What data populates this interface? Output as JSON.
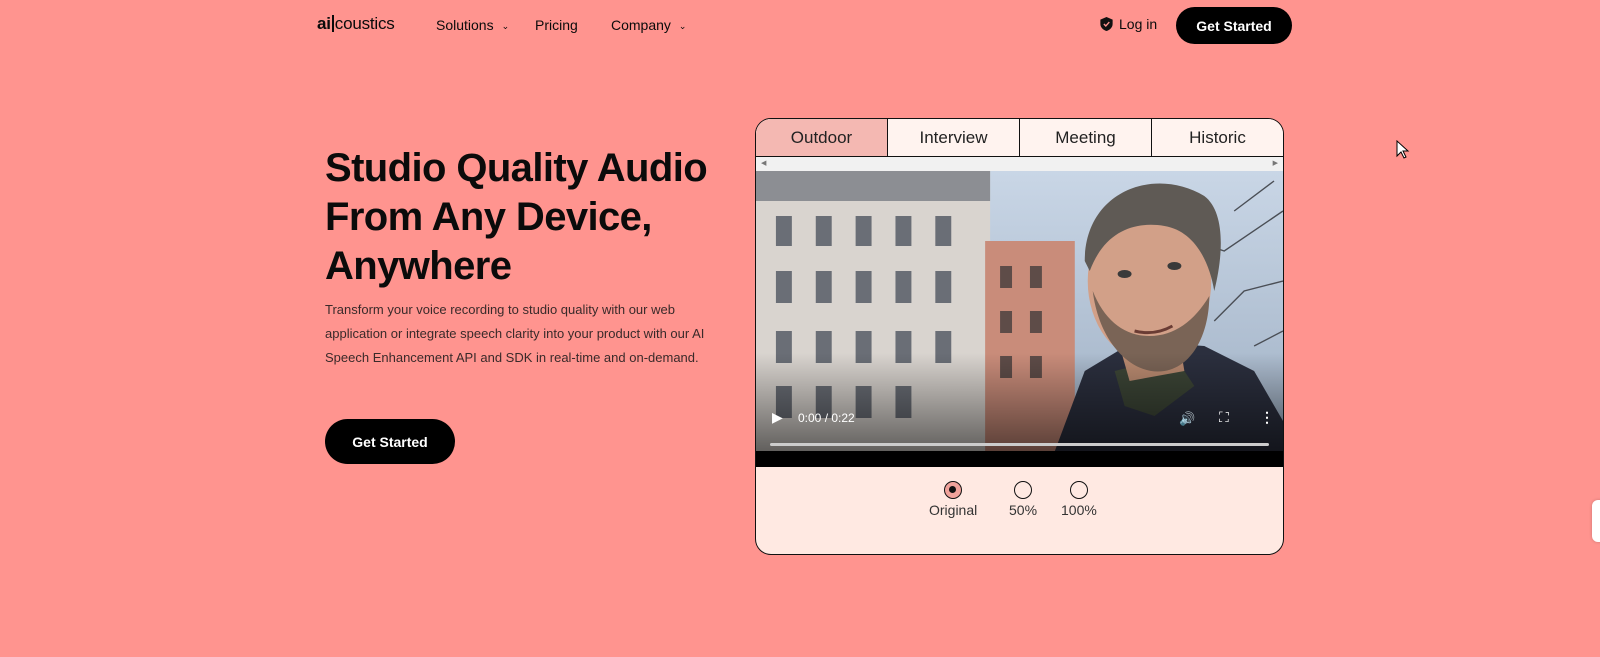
{
  "header": {
    "logo": {
      "bold": "ai",
      "rest": "coustics"
    },
    "nav": [
      {
        "label": "Solutions",
        "has_dropdown": true
      },
      {
        "label": "Pricing",
        "has_dropdown": false
      },
      {
        "label": "Company",
        "has_dropdown": true
      }
    ],
    "login_label": "Log in",
    "cta_label": "Get Started"
  },
  "hero": {
    "title": "Studio Quality Audio From Any Device, Anywhere",
    "description": "Transform your voice recording to studio quality with our web application or integrate speech clarity into your product with our AI Speech Enhancement API and SDK in real-time and on-demand.",
    "cta_label": "Get Started"
  },
  "demo": {
    "tabs": [
      {
        "label": "Outdoor",
        "active": true
      },
      {
        "label": "Interview",
        "active": false
      },
      {
        "label": "Meeting",
        "active": false
      },
      {
        "label": "Historic",
        "active": false
      }
    ],
    "video": {
      "time_display": "0:00 / 0:22",
      "progress": 0
    },
    "enhancement_options": [
      {
        "label": "Original",
        "checked": true
      },
      {
        "label": "50%",
        "checked": false
      },
      {
        "label": "100%",
        "checked": false
      }
    ]
  },
  "colors": {
    "background": "#ff948f",
    "card": "#ffe9e2",
    "active_tab": "#f4b8b2",
    "button": "#000000"
  }
}
